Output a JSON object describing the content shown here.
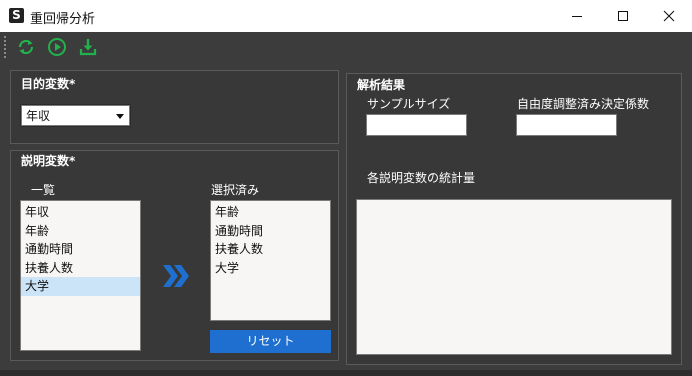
{
  "window": {
    "logo_letter": "S",
    "title": "重回帰分析"
  },
  "toolbar": {
    "refresh_icon": "refresh-icon",
    "run_icon": "play-icon",
    "download_icon": "download-icon"
  },
  "target_variable": {
    "title": "目的変数*",
    "selected": "年収"
  },
  "explanatory": {
    "title": "説明変数*",
    "list_label": "一覧",
    "list_items": [
      "年収",
      "年齢",
      "通勤時間",
      "扶養人数",
      "大学"
    ],
    "selected_index": 4,
    "selected_label": "選択済み",
    "selected_items": [
      "年齢",
      "通勤時間",
      "扶養人数",
      "大学"
    ],
    "reset_label": "リセット"
  },
  "results": {
    "title": "解析結果",
    "sample_size_label": "サンプルサイズ",
    "sample_size_value": "",
    "dof_label": "自由度調整済み決定係数",
    "dof_value": "",
    "stats_label": "各説明変数の統計量"
  },
  "colors": {
    "accent": "#1e6fd0",
    "toolbar_icon": "#22b14c",
    "background": "#3c3c3c"
  }
}
